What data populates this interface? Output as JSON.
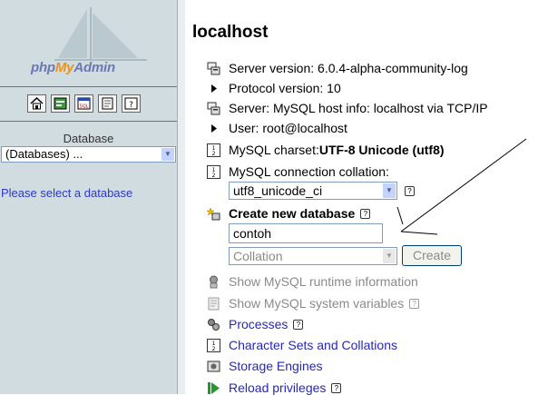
{
  "sidebar": {
    "logo": {
      "php": "php",
      "my": "My",
      "admin": "Admin"
    },
    "nav_icons": [
      "home-icon",
      "query-window-icon",
      "sql-icon",
      "docs-icon",
      "help-icon"
    ],
    "database_label": "Database",
    "database_select": "(Databases) ...",
    "please_select": "Please select a database"
  },
  "main": {
    "title": "localhost",
    "server_version": "Server version: 6.0.4-alpha-community-log",
    "protocol_version": "Protocol version: 10",
    "server_host": "Server: MySQL host info: localhost via TCP/IP",
    "user": "User: root@localhost",
    "charset_label": "MySQL charset: ",
    "charset_value": "UTF-8 Unicode (utf8)",
    "collation_label": "MySQL connection collation:",
    "collation_value": "utf8_unicode_ci",
    "create_db_label": "Create new database",
    "new_db_name": "contoh",
    "collation_placeholder": "Collation",
    "create_button": "Create",
    "links": {
      "runtime": "Show MySQL runtime information",
      "variables": "Show MySQL system variables",
      "processes": "Processes",
      "charsets": "Character Sets and Collations",
      "engines": "Storage Engines",
      "reload": "Reload privileges"
    }
  },
  "colors": {
    "sidebar_bg": "#d0dce0",
    "link": "#2727b9",
    "logo_blue": "#6c78b3",
    "logo_orange": "#f29111"
  }
}
